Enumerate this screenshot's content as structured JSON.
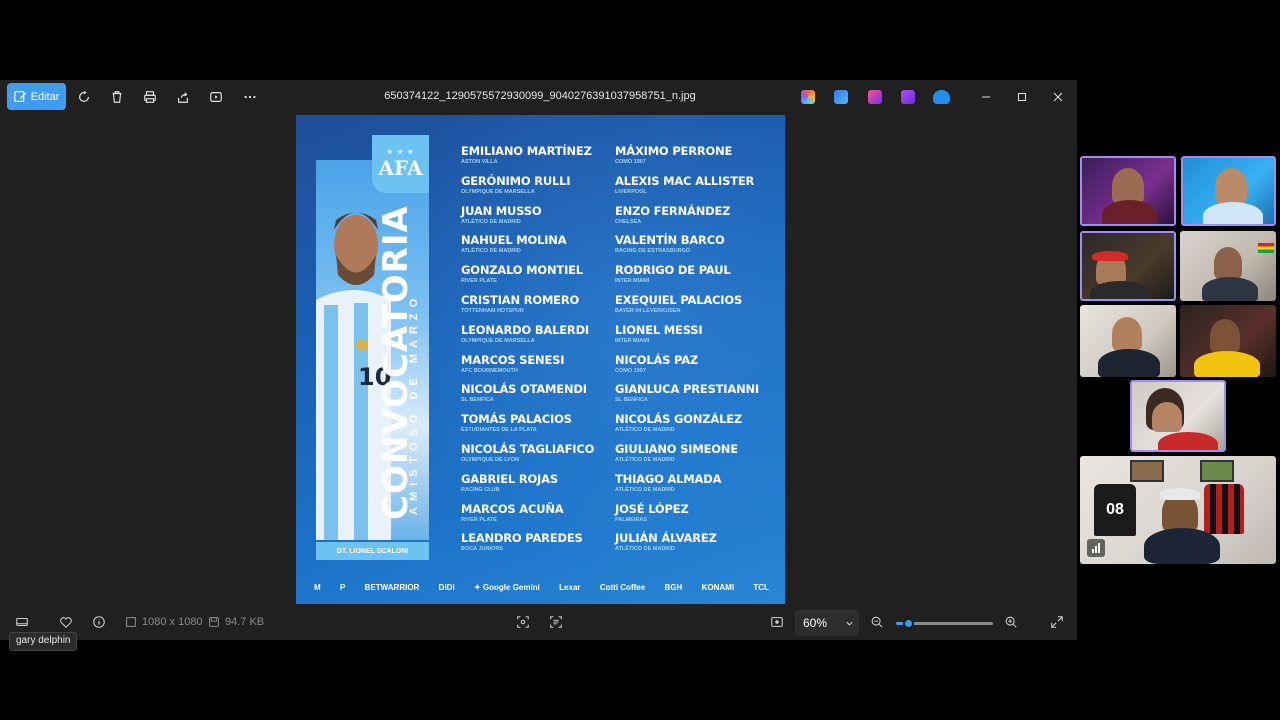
{
  "toolbar": {
    "edit_label": "Editar",
    "file_name": "650374122_1290575572930099_9040276391037958751_n.jpg"
  },
  "poster": {
    "title": "CONVOCATORIA",
    "subtitle": "AMISTOSO DE MARZO",
    "logo_text": "AFA",
    "logo_stars": "★ ★ ★",
    "coach": "DT. LIONEL SCALONI",
    "roster_left": [
      {
        "name": "EMILIANO MARTÍNEZ",
        "club": "ASTON VILLA"
      },
      {
        "name": "GERÓNIMO RULLI",
        "club": "OLYMPIQUE DE MARSELLA"
      },
      {
        "name": "JUAN MUSSO",
        "club": "ATLÉTICO DE MADRID"
      },
      {
        "name": "NAHUEL MOLINA",
        "club": "ATLÉTICO DE MADRID"
      },
      {
        "name": "GONZALO MONTIEL",
        "club": "RIVER PLATE"
      },
      {
        "name": "CRISTIAN ROMERO",
        "club": "TOTTENHAM HOTSPUR"
      },
      {
        "name": "LEONARDO BALERDI",
        "club": "OLYMPIQUE DE MARSELLA"
      },
      {
        "name": "MARCOS SENESI",
        "club": "AFC BOURNEMOUTH"
      },
      {
        "name": "NICOLÁS OTAMENDI",
        "club": "SL BENFICA"
      },
      {
        "name": "TOMÁS PALACIOS",
        "club": "ESTUDIANTES DE LA PLATA"
      },
      {
        "name": "NICOLÁS TAGLIAFICO",
        "club": "OLYMPIQUE DE LYON"
      },
      {
        "name": "GABRIEL ROJAS",
        "club": "RACING CLUB"
      },
      {
        "name": "MARCOS ACUÑA",
        "club": "RIVER PLATE"
      },
      {
        "name": "LEANDRO PAREDES",
        "club": "BOCA JUNIORS"
      }
    ],
    "roster_right": [
      {
        "name": "MÁXIMO PERRONE",
        "club": "COMO 1907"
      },
      {
        "name": "ALEXIS MAC ALLISTER",
        "club": "LIVERPOOL"
      },
      {
        "name": "ENZO FERNÁNDEZ",
        "club": "CHELSEA"
      },
      {
        "name": "VALENTÍN BARCO",
        "club": "RACING DE ESTRASBURGO"
      },
      {
        "name": "RODRIGO DE PAUL",
        "club": "INTER MIAMI"
      },
      {
        "name": "EXEQUIEL PALACIOS",
        "club": "BAYER 04 LEVERKUSEN"
      },
      {
        "name": "LIONEL MESSI",
        "club": "INTER MIAMI"
      },
      {
        "name": "NICOLÁS PAZ",
        "club": "COMO 1907"
      },
      {
        "name": "GIANLUCA PRESTIANNI",
        "club": "SL BENFICA"
      },
      {
        "name": "NICOLÁS GONZÁLEZ",
        "club": "ATLÉTICO DE MADRID"
      },
      {
        "name": "GIULIANO SIMEONE",
        "club": "ATLÉTICO DE MADRID"
      },
      {
        "name": "THIAGO ALMADA",
        "club": "ATLÉTICO DE MADRID"
      },
      {
        "name": "JOSÉ LÓPEZ",
        "club": "PALMEIRAS"
      },
      {
        "name": "JULIÁN ÁLVAREZ",
        "club": "ATLÉTICO DE MADRID"
      }
    ],
    "sponsors": [
      "M",
      "P",
      "BETWARRIOR",
      "DiDi",
      "✦ Google Gemini",
      "Lexar",
      "Cotti Coffee",
      "BGH",
      "KONAMI",
      "TCL"
    ]
  },
  "bottombar": {
    "dimensions": "1080 x 1080",
    "file_size": "94.7 KB",
    "zoom_label": "60%",
    "zoom_level": 0.12
  },
  "tooltip": "gary delphin",
  "colors": {
    "accent": "#3f9cf0",
    "active_cam_border": "#a18cf2",
    "poster_blue": "#1a63b8",
    "afa_sky": "#6cc3f2"
  }
}
